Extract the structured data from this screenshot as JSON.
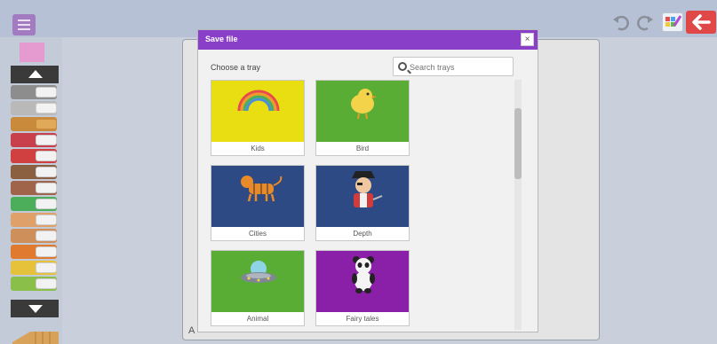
{
  "toolbar": {
    "menu_icon": "hamburger-icon",
    "undo_icon": "undo-icon",
    "redo_icon": "redo-icon",
    "palette_icon": "palette-icon",
    "back_icon": "back-arrow-icon"
  },
  "canvas": {
    "corner_mark": "A"
  },
  "dialog": {
    "title": "Save file",
    "close_label": "×",
    "tray_label": "Choose a tray",
    "search_placeholder": "Search trays",
    "trays": [
      {
        "label": "Kids",
        "color": "#e8de12"
      },
      {
        "label": "Bird",
        "color": "#5aad34"
      },
      {
        "label": "Cities",
        "color": "#2d4a84"
      },
      {
        "label": "Depth",
        "color": "#2d4a84"
      },
      {
        "label": "Animal",
        "color": "#5aad34"
      },
      {
        "label": "Fairy tales",
        "color": "#8a1fa8"
      }
    ]
  },
  "colors": {
    "accent": "#8a3fc8",
    "back": "#e04848"
  }
}
